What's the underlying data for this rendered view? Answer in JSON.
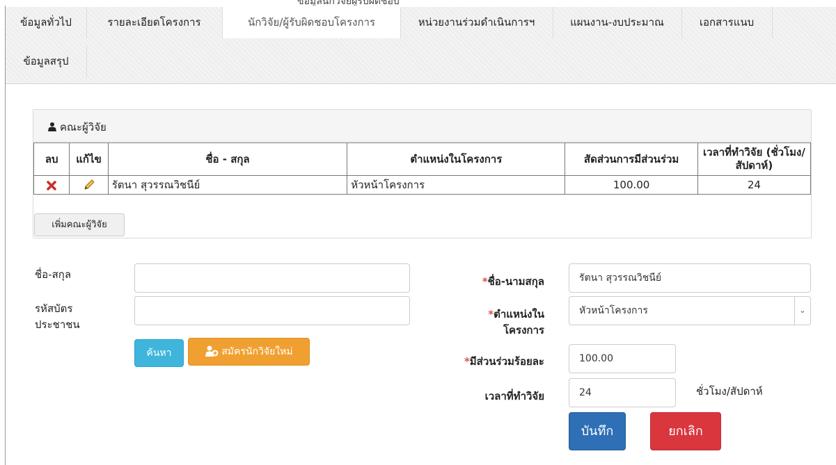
{
  "top_partial_text": "ข้อมูลนักวิจัยผู้รับผิดชอบ",
  "tabs": [
    {
      "label": "ข้อมูลทั่วไป"
    },
    {
      "label": "รายละเอียดโครงการ"
    },
    {
      "label": "นักวิจัย/ผู้รับผิดชอบโครงการ"
    },
    {
      "label": "หน่วยงานร่วมดำเนินการฯ"
    },
    {
      "label": "แผนงาน-งบประมาณ"
    },
    {
      "label": "เอกสารแนบ"
    },
    {
      "label": "ข้อมูลสรุป"
    }
  ],
  "researchers_panel": {
    "title": "คณะผู้วิจัย",
    "columns": {
      "delete": "ลบ",
      "edit": "แก้ไข",
      "name": "ชื่อ - สกุล",
      "position": "ตำแหน่งในโครงการ",
      "share": "สัดส่วนการมีส่วนร่วม",
      "time": "เวลาที่ทำวิจัย (ชั่วโมง/สัปดาห์)"
    },
    "rows": [
      {
        "name": "รัตนา สุวรรณวิชนีย์",
        "position": "หัวหน้าโครงการ",
        "share": "100.00",
        "time": "24"
      }
    ],
    "add_button": "เพิ่มคณะผู้วิจัย"
  },
  "search_form": {
    "name_label": "ชื่อ-สกุล",
    "id_label_1": "รหัสบัตร",
    "id_label_2": "ประชาชน",
    "name_value": "",
    "id_value": "",
    "search_button": "ค้นหา",
    "register_button": "สมัครนักวิจัยใหม่"
  },
  "detail_form": {
    "required_mark": "*",
    "fullname_label": "ชื่อ-นามสกุล",
    "fullname_value": "รัตนา สุวรรณวิชนีย์",
    "position_label_1": "ตำแหน่งใน",
    "position_label_2": "โครงการ",
    "position_value": "หัวหน้าโครงการ",
    "share_label": "มีส่วนร่วมร้อยละ",
    "share_value": "100.00",
    "time_label": "เวลาที่ทำวิจัย",
    "time_value": "24",
    "time_unit": "ชั่วโมง/สัปดาห์",
    "save_button": "บันทึก",
    "cancel_button": "ยกเลิก"
  },
  "colors": {
    "info": "#3fb5dc",
    "warning": "#f0a030",
    "primary": "#2f6fb5",
    "danger": "#d9363e",
    "required": "#d9534f"
  }
}
